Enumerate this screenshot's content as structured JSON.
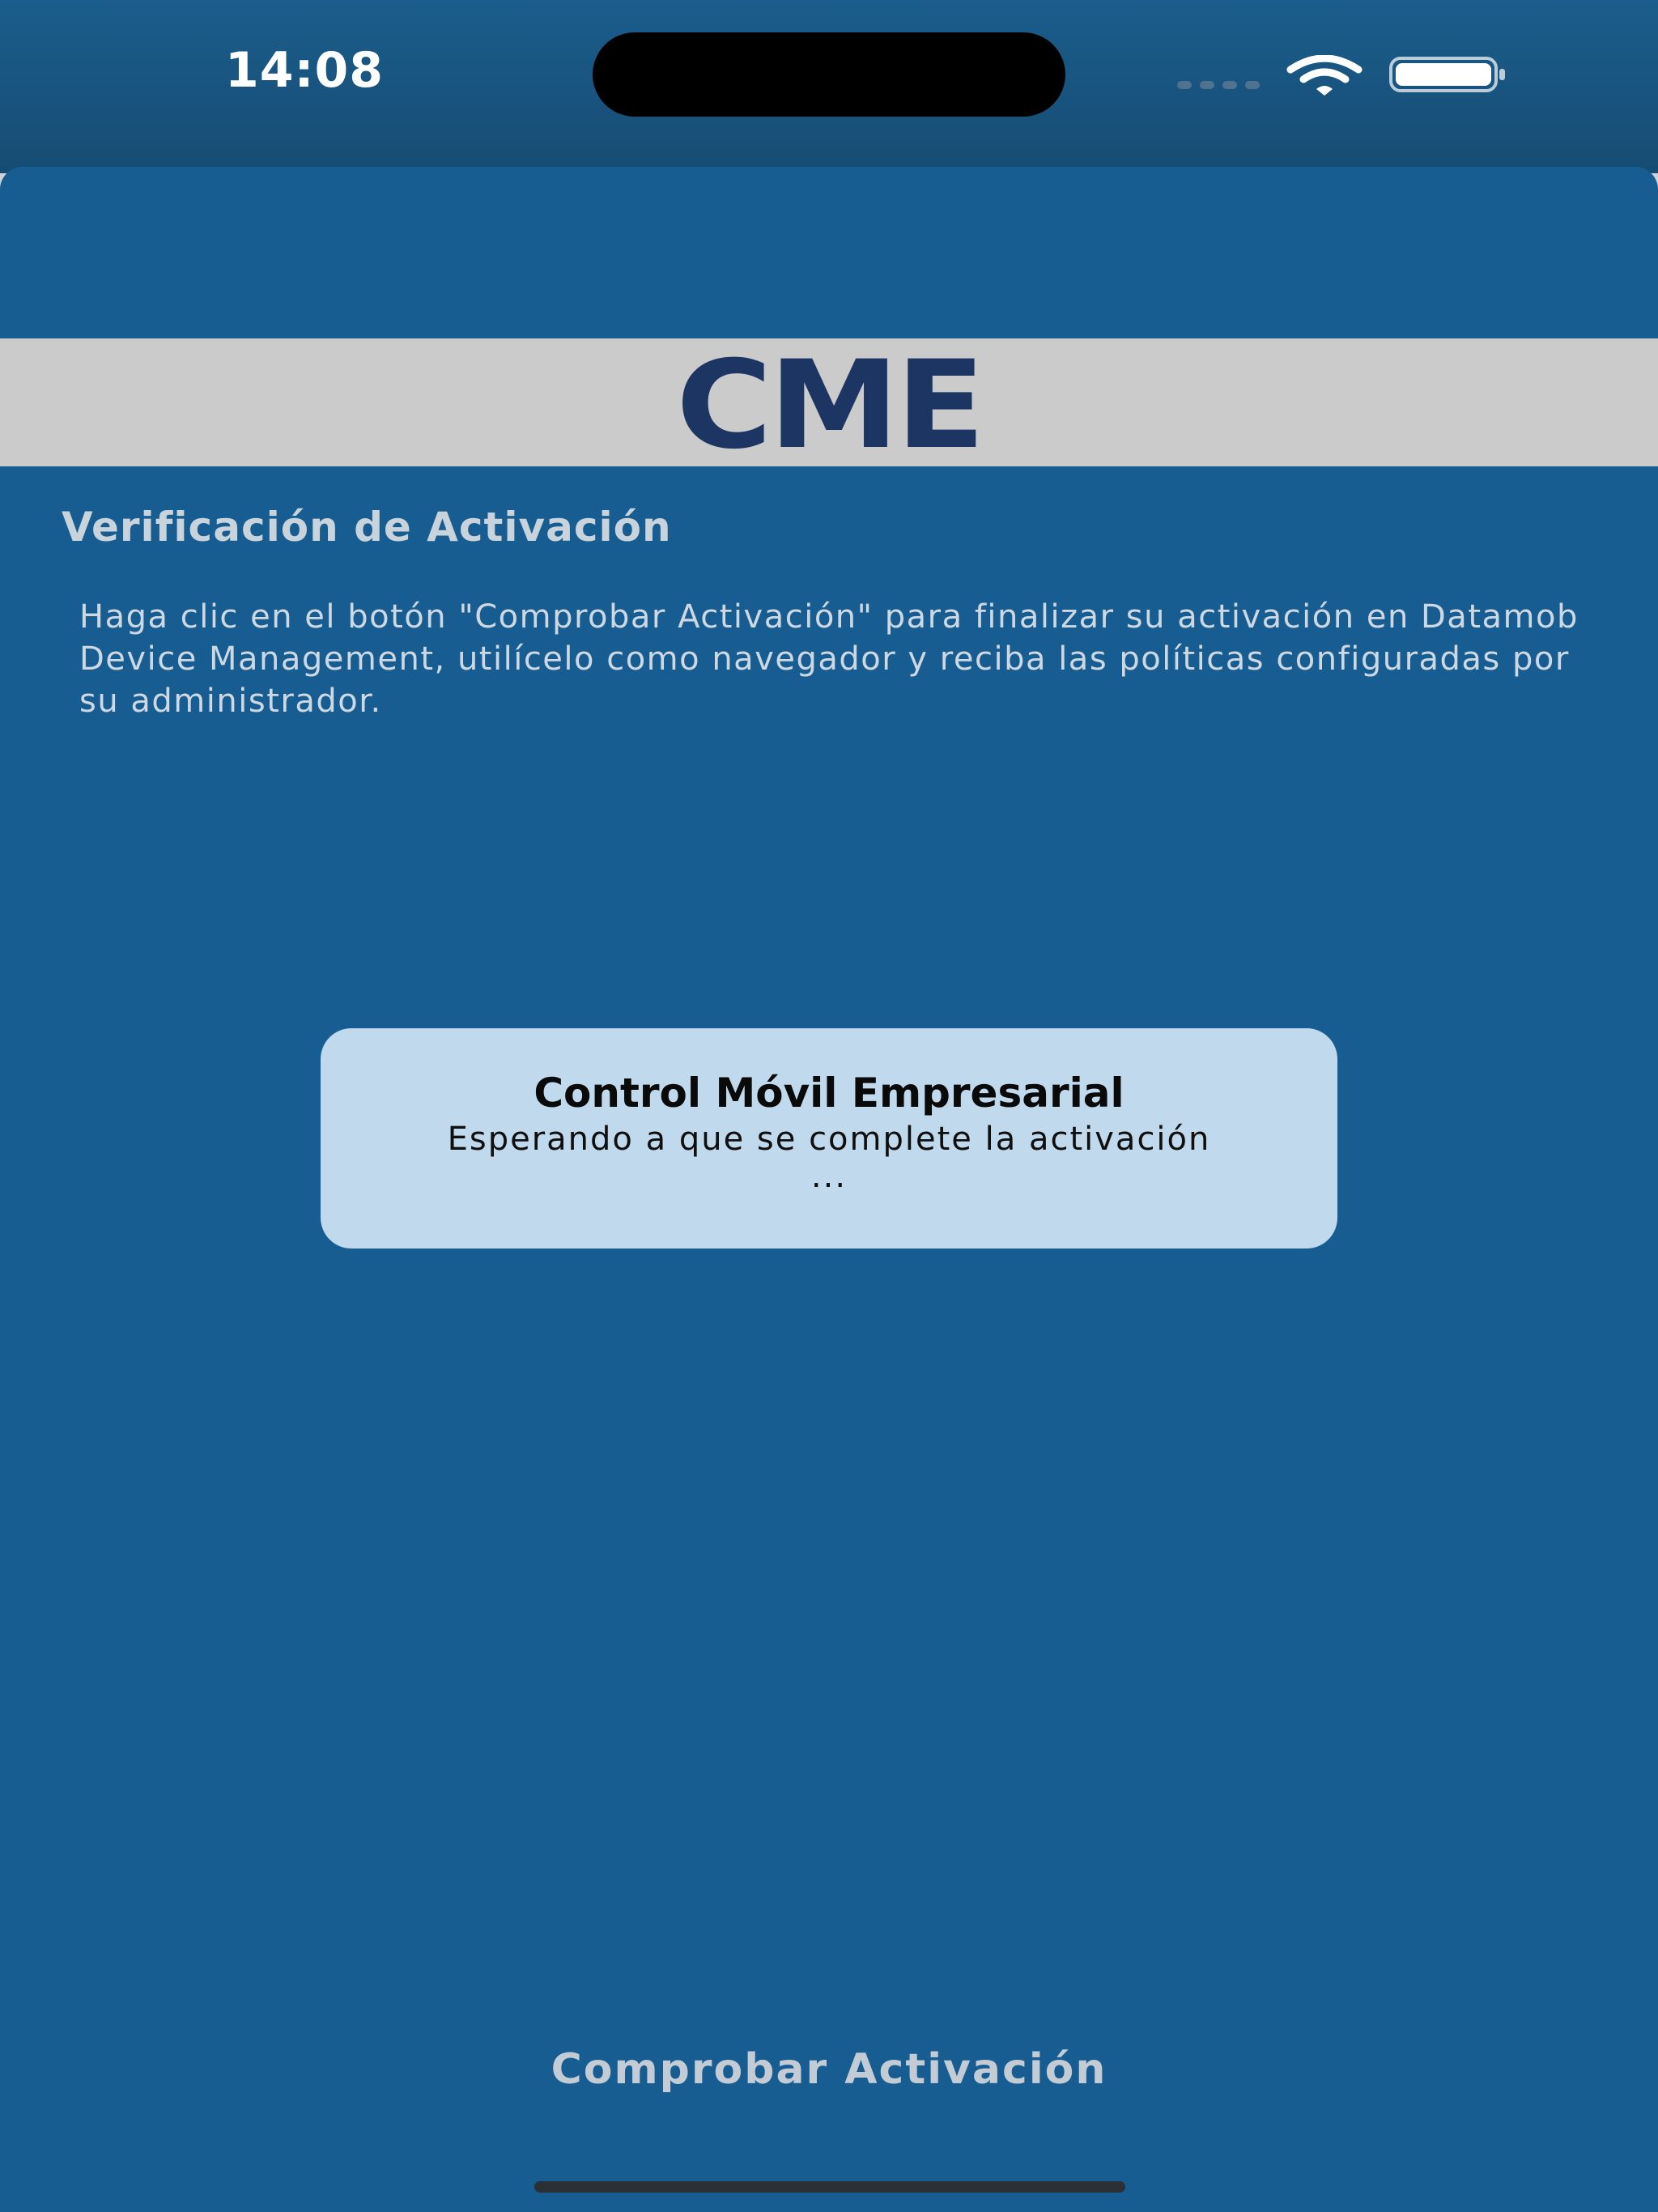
{
  "status_bar": {
    "time": "14:08",
    "wifi_icon": "wifi-icon",
    "battery_icon": "battery-icon"
  },
  "header": {
    "logo_text": "CME"
  },
  "main": {
    "title": "Verificación de Activación",
    "instructions": "Haga clic en el botón \"Comprobar Activación\" para finalizar su activación en Datamob Device Management, utilícelo como navegador y reciba las políticas configuradas por su administrador."
  },
  "dialog": {
    "title": "Control Móvil Empresarial",
    "message": "Esperando a que se complete la activación ..."
  },
  "footer": {
    "check_button_label": "Comprobar Activación"
  },
  "colors": {
    "background": "#175d92",
    "logo_band": "#cbcbcb",
    "logo": "#1d3563",
    "dialog": "#c0d9ed"
  }
}
